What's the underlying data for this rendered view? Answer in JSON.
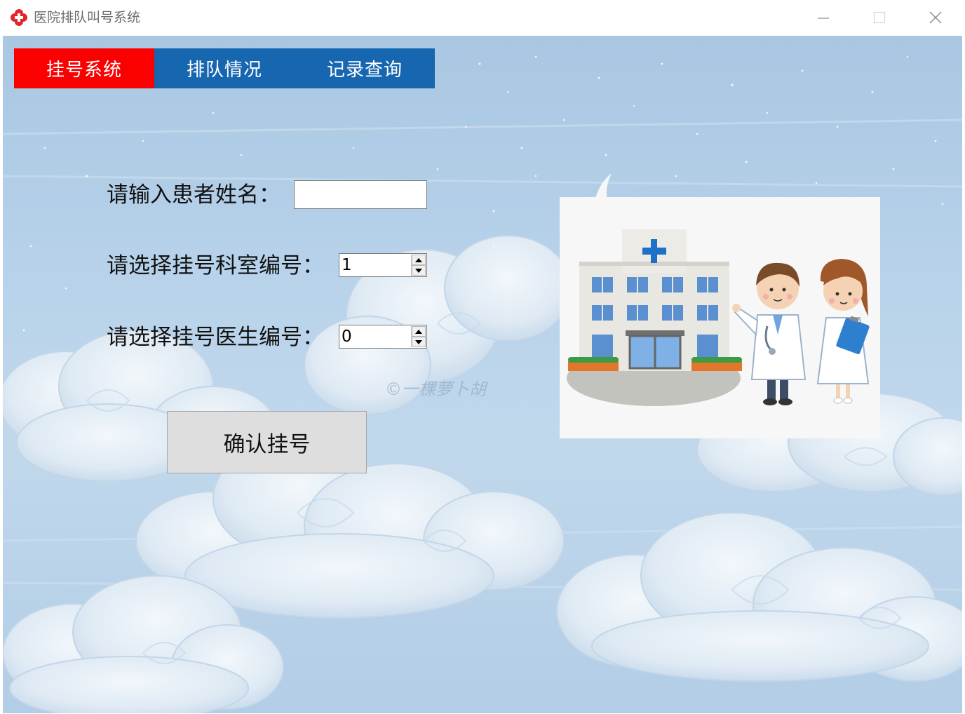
{
  "window": {
    "title": "医院排队叫号系统",
    "icon": "hospital-cross-icon",
    "controls": [
      "minimize-icon",
      "maximize-icon",
      "close-icon"
    ]
  },
  "tabs": [
    {
      "label": "挂号系统",
      "active": true
    },
    {
      "label": "排队情况",
      "active": false
    },
    {
      "label": "记录查询",
      "active": false
    }
  ],
  "form": {
    "name_label": "请输入患者姓名：",
    "name_value": "",
    "department_label": "请选择挂号科室编号：",
    "department_value": "1",
    "doctor_label": "请选择挂号医生编号：",
    "doctor_value": "0",
    "confirm_label": "确认挂号"
  },
  "watermark": "©一棵萝卜胡",
  "illustration": "hospital-with-doctor-and-nurse",
  "colors": {
    "active_tab": "#fb0000",
    "inactive_tab": "#1666b0",
    "title_text": "#6b6b6b",
    "button_bg": "#dedede"
  }
}
